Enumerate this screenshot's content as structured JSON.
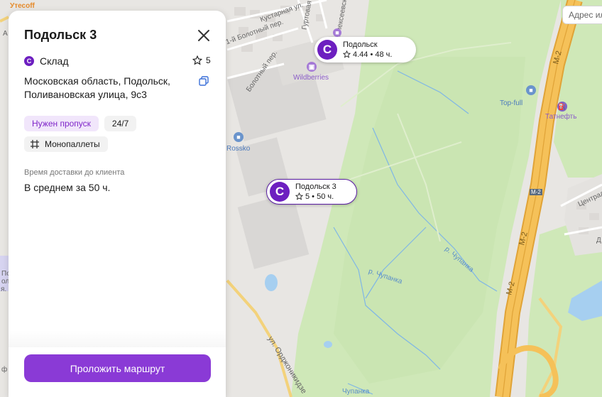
{
  "panel": {
    "title": "Подольск 3",
    "type_label": "Склад",
    "rating": "5",
    "address": "Московская область, Подольск, Поливановская улица, 9с3",
    "tags": [
      "Нужен пропуск",
      "24/7"
    ],
    "pallet_tag": "Монопаллеты",
    "delivery_label": "Время доставки до клиента",
    "delivery_value": "В среднем за 50 ч.",
    "route_button": "Проложить маршрут"
  },
  "markers": [
    {
      "name": "Подольск",
      "meta": "4.44 • 48 ч.",
      "active": false
    },
    {
      "name": "Подольск 3",
      "meta": "5 • 50 ч.",
      "active": true
    }
  ],
  "brand_logo_letter": "C",
  "search": {
    "placeholder": "Адрес или"
  },
  "map_labels": {
    "top_left_brand": "Утесоff",
    "streets": [
      "Кустарная ул.",
      "1-й Болотный пер.",
      "Болотный пер.",
      "Гуртовая",
      "Алексеевская",
      "ул. Орджоникидзе",
      "Центральная",
      "р. Чупанка",
      "р. Чупанка",
      "Чупанка",
      "М-2",
      "М-2",
      "М-2"
    ],
    "pois": [
      "Wildberries",
      "Rossko",
      "Top-full",
      "Татнефть"
    ],
    "left_edge_fragments": [
      "А",
      "По",
      "ол",
      "я. Н",
      "ф",
      "Д"
    ]
  },
  "colors": {
    "accent": "#8a3ad6",
    "brand": "#6d1fc0",
    "pass_tag_bg": "#f1e6fb",
    "pass_tag_text": "#7f26c9",
    "map_green": "#cfe8b8",
    "map_urban": "#e6e3e0",
    "highway": "#f2b94a"
  },
  "icons": [
    "close-icon",
    "star-icon",
    "copy-icon",
    "pallet-icon",
    "search-icon"
  ]
}
